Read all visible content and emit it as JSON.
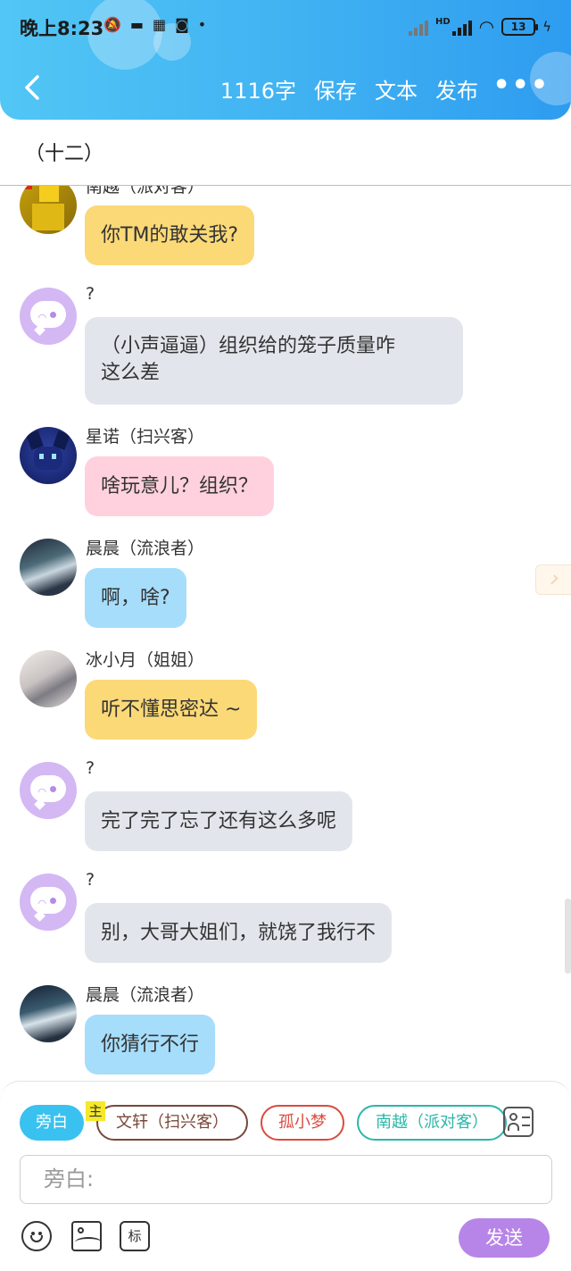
{
  "status_bar": {
    "time": "晚上8:23",
    "net_label": "HD",
    "battery": "13"
  },
  "nav": {
    "word_count": "1116字",
    "save": "保存",
    "text": "文本",
    "publish": "发布",
    "more": "•••"
  },
  "chapter": {
    "title": "（十二）"
  },
  "messages": [
    {
      "name": "南越（派对客）",
      "text": "你TM的敢关我?",
      "color": "yellow"
    },
    {
      "name": "?",
      "text_line1": "（小声逼逼）组织给的笼子质量咋",
      "text_line2": "这么差",
      "color": "gray"
    },
    {
      "name": "星诺（扫兴客）",
      "text": "啥玩意儿？组织？",
      "color": "pink"
    },
    {
      "name": "晨晨（流浪者）",
      "text": "啊，啥?",
      "color": "blue"
    },
    {
      "name": "冰小月（姐姐）",
      "text": "听不懂思密达 ~",
      "color": "yellow"
    },
    {
      "name": "?",
      "text": "完了完了忘了还有这么多呢",
      "color": "gray"
    },
    {
      "name": "?",
      "text": "别，大哥大姐们，就饶了我行不",
      "color": "gray"
    },
    {
      "name": "晨晨（流浪者）",
      "text": "你猜行不行",
      "color": "blue"
    }
  ],
  "composer": {
    "roles": [
      {
        "label": "旁白",
        "color": "#39c1ef"
      },
      {
        "label": "文轩（扫兴客）",
        "color": "#7a4738"
      },
      {
        "label": "孤小梦",
        "color": "#d94b40"
      },
      {
        "label": "南越（派对客）",
        "color": "#2bb7a8"
      }
    ],
    "owner_badge": "主",
    "input_placeholder": "旁白:",
    "mark_label": "标",
    "send": "发送"
  }
}
